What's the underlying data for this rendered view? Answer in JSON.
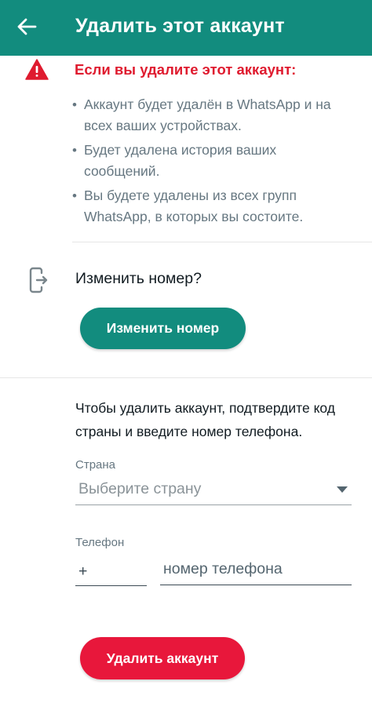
{
  "appbar": {
    "title": "Удалить этот аккаунт",
    "back_icon": "arrow-left-icon",
    "color": "#128C7E"
  },
  "warning": {
    "icon": "warning-triangle-icon",
    "title": "Если вы удалите этот аккаунт:",
    "color": "#DF1B2F",
    "bullets": [
      "Аккаунт будет удалён в WhatsApp и на всех ваших устройствах.",
      "Будет удалена история ваших сообщений.",
      "Вы будете удалены из всех групп WhatsApp, в которых вы состоите."
    ],
    "bullet_mark": "•"
  },
  "change_number": {
    "icon": "phone-change-icon",
    "question": "Изменить номер?",
    "button_label": "Изменить номер"
  },
  "confirm": {
    "text": "Чтобы удалить аккаунт, подтвердите код страны и введите номер телефона.",
    "country_label": "Страна",
    "country_placeholder": "Выберите страну",
    "phone_label": "Телефон",
    "plus": "+",
    "phone_placeholder": "номер телефона",
    "delete_button_label": "Удалить аккаунт",
    "delete_color": "#E8173B"
  }
}
